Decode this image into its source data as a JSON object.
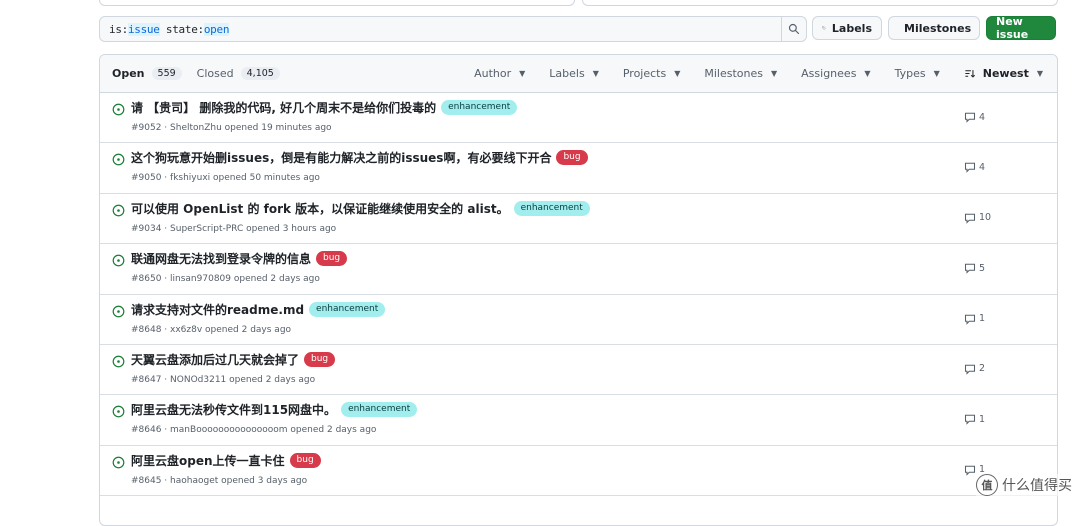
{
  "search": {
    "prefix_key": "is:",
    "prefix_val": "issue",
    "state_key": " state:",
    "state_val": "open"
  },
  "buttons": {
    "labels": "Labels",
    "milestones": "Milestones",
    "new_issue": "New issue"
  },
  "header": {
    "open_label": "Open",
    "open_count": "559",
    "closed_label": "Closed",
    "closed_count": "4,105",
    "filters": [
      "Author",
      "Labels",
      "Projects",
      "Milestones",
      "Assignees",
      "Types"
    ],
    "sort_label": "Newest"
  },
  "issues": [
    {
      "title": "请 【贵司】 删除我的代码, 好几个周末不是给你们投毒的",
      "label": "enhancement",
      "label_type": "enhancement",
      "meta": "#9052 · SheltonZhu opened 19 minutes ago",
      "comments": "4"
    },
    {
      "title": "这个狗玩意开始删issues，倒是有能力解决之前的issues啊，有必要线下开合",
      "label": "bug",
      "label_type": "bug",
      "meta": "#9050 · fkshiyuxi opened 50 minutes ago",
      "comments": "4"
    },
    {
      "title": "可以使用 OpenList 的 fork 版本，以保证能继续使用安全的 alist。",
      "label": "enhancement",
      "label_type": "enhancement",
      "meta": "#9034 · SuperScript-PRC opened 3 hours ago",
      "comments": "10"
    },
    {
      "title": "联通网盘无法找到登录令牌的信息",
      "label": "bug",
      "label_type": "bug",
      "meta": "#8650 · linsan970809 opened 2 days ago",
      "comments": "5"
    },
    {
      "title": "请求支持对文件的readme.md",
      "label": "enhancement",
      "label_type": "enhancement",
      "meta": "#8648 · xx6z8v opened 2 days ago",
      "comments": "1"
    },
    {
      "title": "天翼云盘添加后过几天就会掉了",
      "label": "bug",
      "label_type": "bug",
      "meta": "#8647 · NONOd3211 opened 2 days ago",
      "comments": "2"
    },
    {
      "title": "阿里云盘无法秒传文件到115网盘中。",
      "label": "enhancement",
      "label_type": "enhancement",
      "meta": "#8646 · manBooooooooooooooom opened 2 days ago",
      "comments": "1"
    },
    {
      "title": "阿里云盘open上传一直卡住",
      "label": "bug",
      "label_type": "bug",
      "meta": "#8645 · haohaoget opened 3 days ago",
      "comments": "1"
    }
  ],
  "watermark": {
    "text": "什么值得买",
    "logo": "值"
  },
  "colors": {
    "open_green": "#1a7f37",
    "primary_btn": "#1f883d",
    "bug": "#d73a4a",
    "enhancement": "#a2eeef"
  }
}
